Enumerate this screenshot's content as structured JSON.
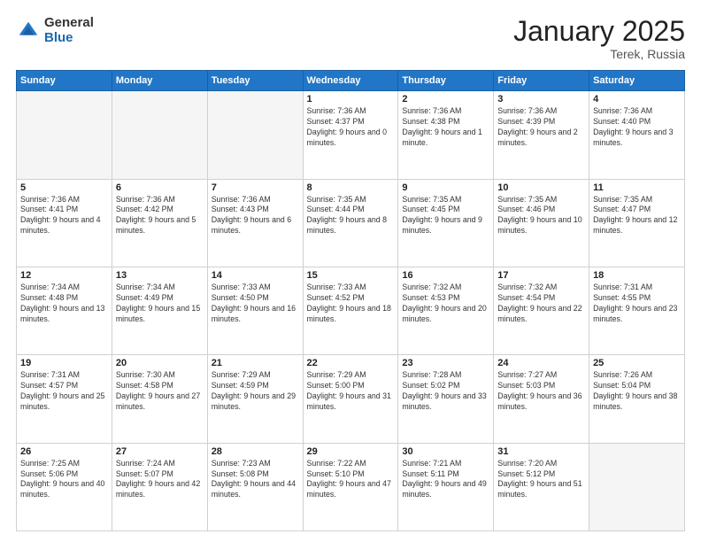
{
  "header": {
    "logo_general": "General",
    "logo_blue": "Blue",
    "month_title": "January 2025",
    "location": "Terek, Russia"
  },
  "days_of_week": [
    "Sunday",
    "Monday",
    "Tuesday",
    "Wednesday",
    "Thursday",
    "Friday",
    "Saturday"
  ],
  "weeks": [
    [
      {
        "day": "",
        "empty": true
      },
      {
        "day": "",
        "empty": true
      },
      {
        "day": "",
        "empty": true
      },
      {
        "day": "1",
        "sunrise": "Sunrise: 7:36 AM",
        "sunset": "Sunset: 4:37 PM",
        "daylight": "Daylight: 9 hours and 0 minutes."
      },
      {
        "day": "2",
        "sunrise": "Sunrise: 7:36 AM",
        "sunset": "Sunset: 4:38 PM",
        "daylight": "Daylight: 9 hours and 1 minute."
      },
      {
        "day": "3",
        "sunrise": "Sunrise: 7:36 AM",
        "sunset": "Sunset: 4:39 PM",
        "daylight": "Daylight: 9 hours and 2 minutes."
      },
      {
        "day": "4",
        "sunrise": "Sunrise: 7:36 AM",
        "sunset": "Sunset: 4:40 PM",
        "daylight": "Daylight: 9 hours and 3 minutes."
      }
    ],
    [
      {
        "day": "5",
        "sunrise": "Sunrise: 7:36 AM",
        "sunset": "Sunset: 4:41 PM",
        "daylight": "Daylight: 9 hours and 4 minutes."
      },
      {
        "day": "6",
        "sunrise": "Sunrise: 7:36 AM",
        "sunset": "Sunset: 4:42 PM",
        "daylight": "Daylight: 9 hours and 5 minutes."
      },
      {
        "day": "7",
        "sunrise": "Sunrise: 7:36 AM",
        "sunset": "Sunset: 4:43 PM",
        "daylight": "Daylight: 9 hours and 6 minutes."
      },
      {
        "day": "8",
        "sunrise": "Sunrise: 7:35 AM",
        "sunset": "Sunset: 4:44 PM",
        "daylight": "Daylight: 9 hours and 8 minutes."
      },
      {
        "day": "9",
        "sunrise": "Sunrise: 7:35 AM",
        "sunset": "Sunset: 4:45 PM",
        "daylight": "Daylight: 9 hours and 9 minutes."
      },
      {
        "day": "10",
        "sunrise": "Sunrise: 7:35 AM",
        "sunset": "Sunset: 4:46 PM",
        "daylight": "Daylight: 9 hours and 10 minutes."
      },
      {
        "day": "11",
        "sunrise": "Sunrise: 7:35 AM",
        "sunset": "Sunset: 4:47 PM",
        "daylight": "Daylight: 9 hours and 12 minutes."
      }
    ],
    [
      {
        "day": "12",
        "sunrise": "Sunrise: 7:34 AM",
        "sunset": "Sunset: 4:48 PM",
        "daylight": "Daylight: 9 hours and 13 minutes."
      },
      {
        "day": "13",
        "sunrise": "Sunrise: 7:34 AM",
        "sunset": "Sunset: 4:49 PM",
        "daylight": "Daylight: 9 hours and 15 minutes."
      },
      {
        "day": "14",
        "sunrise": "Sunrise: 7:33 AM",
        "sunset": "Sunset: 4:50 PM",
        "daylight": "Daylight: 9 hours and 16 minutes."
      },
      {
        "day": "15",
        "sunrise": "Sunrise: 7:33 AM",
        "sunset": "Sunset: 4:52 PM",
        "daylight": "Daylight: 9 hours and 18 minutes."
      },
      {
        "day": "16",
        "sunrise": "Sunrise: 7:32 AM",
        "sunset": "Sunset: 4:53 PM",
        "daylight": "Daylight: 9 hours and 20 minutes."
      },
      {
        "day": "17",
        "sunrise": "Sunrise: 7:32 AM",
        "sunset": "Sunset: 4:54 PM",
        "daylight": "Daylight: 9 hours and 22 minutes."
      },
      {
        "day": "18",
        "sunrise": "Sunrise: 7:31 AM",
        "sunset": "Sunset: 4:55 PM",
        "daylight": "Daylight: 9 hours and 23 minutes."
      }
    ],
    [
      {
        "day": "19",
        "sunrise": "Sunrise: 7:31 AM",
        "sunset": "Sunset: 4:57 PM",
        "daylight": "Daylight: 9 hours and 25 minutes."
      },
      {
        "day": "20",
        "sunrise": "Sunrise: 7:30 AM",
        "sunset": "Sunset: 4:58 PM",
        "daylight": "Daylight: 9 hours and 27 minutes."
      },
      {
        "day": "21",
        "sunrise": "Sunrise: 7:29 AM",
        "sunset": "Sunset: 4:59 PM",
        "daylight": "Daylight: 9 hours and 29 minutes."
      },
      {
        "day": "22",
        "sunrise": "Sunrise: 7:29 AM",
        "sunset": "Sunset: 5:00 PM",
        "daylight": "Daylight: 9 hours and 31 minutes."
      },
      {
        "day": "23",
        "sunrise": "Sunrise: 7:28 AM",
        "sunset": "Sunset: 5:02 PM",
        "daylight": "Daylight: 9 hours and 33 minutes."
      },
      {
        "day": "24",
        "sunrise": "Sunrise: 7:27 AM",
        "sunset": "Sunset: 5:03 PM",
        "daylight": "Daylight: 9 hours and 36 minutes."
      },
      {
        "day": "25",
        "sunrise": "Sunrise: 7:26 AM",
        "sunset": "Sunset: 5:04 PM",
        "daylight": "Daylight: 9 hours and 38 minutes."
      }
    ],
    [
      {
        "day": "26",
        "sunrise": "Sunrise: 7:25 AM",
        "sunset": "Sunset: 5:06 PM",
        "daylight": "Daylight: 9 hours and 40 minutes."
      },
      {
        "day": "27",
        "sunrise": "Sunrise: 7:24 AM",
        "sunset": "Sunset: 5:07 PM",
        "daylight": "Daylight: 9 hours and 42 minutes."
      },
      {
        "day": "28",
        "sunrise": "Sunrise: 7:23 AM",
        "sunset": "Sunset: 5:08 PM",
        "daylight": "Daylight: 9 hours and 44 minutes."
      },
      {
        "day": "29",
        "sunrise": "Sunrise: 7:22 AM",
        "sunset": "Sunset: 5:10 PM",
        "daylight": "Daylight: 9 hours and 47 minutes."
      },
      {
        "day": "30",
        "sunrise": "Sunrise: 7:21 AM",
        "sunset": "Sunset: 5:11 PM",
        "daylight": "Daylight: 9 hours and 49 minutes."
      },
      {
        "day": "31",
        "sunrise": "Sunrise: 7:20 AM",
        "sunset": "Sunset: 5:12 PM",
        "daylight": "Daylight: 9 hours and 51 minutes."
      },
      {
        "day": "",
        "empty": true
      }
    ]
  ]
}
